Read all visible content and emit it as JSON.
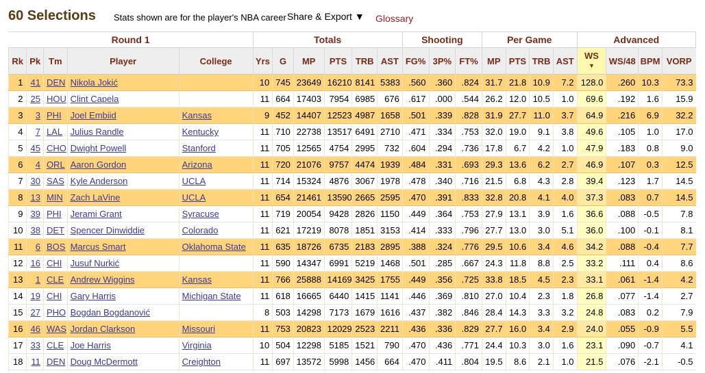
{
  "header": {
    "title": "60 Selections",
    "note": "Stats shown are for the player's NBA career",
    "share_label": "Share & Export ▼",
    "glossary_label": "Glossary"
  },
  "groups": {
    "round": "Round 1",
    "totals": "Totals",
    "shooting": "Shooting",
    "per_game": "Per Game",
    "advanced": "Advanced"
  },
  "columns": [
    "Rk",
    "Pk",
    "Tm",
    "Player",
    "College",
    "Yrs",
    "G",
    "MP",
    "PTS",
    "TRB",
    "AST",
    "FG%",
    "3P%",
    "FT%",
    "MP",
    "PTS",
    "TRB",
    "AST",
    "WS",
    "WS/48",
    "BPM",
    "VORP"
  ],
  "sort_indicator": "▼",
  "rows": [
    {
      "rk": "1",
      "pk": "41",
      "tm": "DEN",
      "player": "Nikola Jokić",
      "college": "",
      "yrs": "10",
      "g": "745",
      "mp": "23649",
      "pts": "16210",
      "trb": "8141",
      "ast": "5383",
      "fg": ".560",
      "tp": ".360",
      "ft": ".824",
      "mpg": "31.7",
      "ptsg": "21.8",
      "trbg": "10.9",
      "astg": "7.2",
      "ws": "128.0",
      "ws48": ".260",
      "bpm": "10.3",
      "vorp": "73.3",
      "hl": true
    },
    {
      "rk": "2",
      "pk": "25",
      "tm": "HOU",
      "player": "Clint Capela",
      "college": "",
      "yrs": "11",
      "g": "664",
      "mp": "17403",
      "pts": "7954",
      "trb": "6985",
      "ast": "676",
      "fg": ".617",
      "tp": ".000",
      "ft": ".544",
      "mpg": "26.2",
      "ptsg": "12.0",
      "trbg": "10.5",
      "astg": "1.0",
      "ws": "69.6",
      "ws48": ".192",
      "bpm": "1.6",
      "vorp": "15.9",
      "hl": false
    },
    {
      "rk": "3",
      "pk": "3",
      "tm": "PHI",
      "player": "Joel Embiid",
      "college": "Kansas",
      "yrs": "9",
      "g": "452",
      "mp": "14407",
      "pts": "12523",
      "trb": "4987",
      "ast": "1658",
      "fg": ".501",
      "tp": ".339",
      "ft": ".828",
      "mpg": "31.9",
      "ptsg": "27.7",
      "trbg": "11.0",
      "astg": "3.7",
      "ws": "64.9",
      "ws48": ".216",
      "bpm": "6.9",
      "vorp": "32.2",
      "hl": true
    },
    {
      "rk": "4",
      "pk": "7",
      "tm": "LAL",
      "player": "Julius Randle",
      "college": "Kentucky",
      "yrs": "11",
      "g": "710",
      "mp": "22738",
      "pts": "13517",
      "trb": "6491",
      "ast": "2710",
      "fg": ".471",
      "tp": ".334",
      "ft": ".753",
      "mpg": "32.0",
      "ptsg": "19.0",
      "trbg": "9.1",
      "astg": "3.8",
      "ws": "49.6",
      "ws48": ".105",
      "bpm": "1.0",
      "vorp": "17.0",
      "hl": false
    },
    {
      "rk": "5",
      "pk": "45",
      "tm": "CHO",
      "player": "Dwight Powell",
      "college": "Stanford",
      "yrs": "11",
      "g": "705",
      "mp": "12565",
      "pts": "4754",
      "trb": "2995",
      "ast": "732",
      "fg": ".604",
      "tp": ".294",
      "ft": ".736",
      "mpg": "17.8",
      "ptsg": "6.7",
      "trbg": "4.2",
      "astg": "1.0",
      "ws": "47.9",
      "ws48": ".183",
      "bpm": "0.8",
      "vorp": "9.0",
      "hl": false
    },
    {
      "rk": "6",
      "pk": "4",
      "tm": "ORL",
      "player": "Aaron Gordon",
      "college": "Arizona",
      "yrs": "11",
      "g": "720",
      "mp": "21076",
      "pts": "9757",
      "trb": "4474",
      "ast": "1939",
      "fg": ".484",
      "tp": ".331",
      "ft": ".693",
      "mpg": "29.3",
      "ptsg": "13.6",
      "trbg": "6.2",
      "astg": "2.7",
      "ws": "46.9",
      "ws48": ".107",
      "bpm": "0.3",
      "vorp": "12.5",
      "hl": true
    },
    {
      "rk": "7",
      "pk": "30",
      "tm": "SAS",
      "player": "Kyle Anderson",
      "college": "UCLA",
      "yrs": "11",
      "g": "714",
      "mp": "15324",
      "pts": "4876",
      "trb": "3067",
      "ast": "1978",
      "fg": ".478",
      "tp": ".340",
      "ft": ".716",
      "mpg": "21.5",
      "ptsg": "6.8",
      "trbg": "4.3",
      "astg": "2.8",
      "ws": "39.4",
      "ws48": ".123",
      "bpm": "1.7",
      "vorp": "14.5",
      "hl": false
    },
    {
      "rk": "8",
      "pk": "13",
      "tm": "MIN",
      "player": "Zach LaVine",
      "college": "UCLA",
      "yrs": "11",
      "g": "654",
      "mp": "21461",
      "pts": "13590",
      "trb": "2665",
      "ast": "2595",
      "fg": ".470",
      "tp": ".391",
      "ft": ".833",
      "mpg": "32.8",
      "ptsg": "20.8",
      "trbg": "4.1",
      "astg": "4.0",
      "ws": "37.3",
      "ws48": ".083",
      "bpm": "0.7",
      "vorp": "14.5",
      "hl": true
    },
    {
      "rk": "9",
      "pk": "39",
      "tm": "PHI",
      "player": "Jerami Grant",
      "college": "Syracuse",
      "yrs": "11",
      "g": "719",
      "mp": "20054",
      "pts": "9428",
      "trb": "2826",
      "ast": "1150",
      "fg": ".449",
      "tp": ".364",
      "ft": ".753",
      "mpg": "27.9",
      "ptsg": "13.1",
      "trbg": "3.9",
      "astg": "1.6",
      "ws": "36.6",
      "ws48": ".088",
      "bpm": "-0.5",
      "vorp": "7.8",
      "hl": false
    },
    {
      "rk": "10",
      "pk": "38",
      "tm": "DET",
      "player": "Spencer Dinwiddie",
      "college": "Colorado",
      "yrs": "11",
      "g": "621",
      "mp": "17219",
      "pts": "8078",
      "trb": "1851",
      "ast": "3153",
      "fg": ".414",
      "tp": ".333",
      "ft": ".796",
      "mpg": "27.7",
      "ptsg": "13.0",
      "trbg": "3.0",
      "astg": "5.1",
      "ws": "36.0",
      "ws48": ".100",
      "bpm": "-0.1",
      "vorp": "8.1",
      "hl": false
    },
    {
      "rk": "11",
      "pk": "6",
      "tm": "BOS",
      "player": "Marcus Smart",
      "college": "Oklahoma State",
      "yrs": "11",
      "g": "635",
      "mp": "18726",
      "pts": "6735",
      "trb": "2183",
      "ast": "2895",
      "fg": ".388",
      "tp": ".324",
      "ft": ".776",
      "mpg": "29.5",
      "ptsg": "10.6",
      "trbg": "3.4",
      "astg": "4.6",
      "ws": "34.2",
      "ws48": ".088",
      "bpm": "-0.4",
      "vorp": "7.7",
      "hl": true
    },
    {
      "rk": "12",
      "pk": "16",
      "tm": "CHI",
      "player": "Jusuf Nurkić",
      "college": "",
      "yrs": "11",
      "g": "590",
      "mp": "14347",
      "pts": "6991",
      "trb": "5219",
      "ast": "1468",
      "fg": ".501",
      "tp": ".285",
      "ft": ".667",
      "mpg": "24.3",
      "ptsg": "11.8",
      "trbg": "8.8",
      "astg": "2.5",
      "ws": "33.2",
      "ws48": ".111",
      "bpm": "0.4",
      "vorp": "8.6",
      "hl": false
    },
    {
      "rk": "13",
      "pk": "1",
      "tm": "CLE",
      "player": "Andrew Wiggins",
      "college": "Kansas",
      "yrs": "11",
      "g": "766",
      "mp": "25888",
      "pts": "14169",
      "trb": "3425",
      "ast": "1755",
      "fg": ".449",
      "tp": ".356",
      "ft": ".725",
      "mpg": "33.8",
      "ptsg": "18.5",
      "trbg": "4.5",
      "astg": "2.3",
      "ws": "33.1",
      "ws48": ".061",
      "bpm": "-1.4",
      "vorp": "4.2",
      "hl": true
    },
    {
      "rk": "14",
      "pk": "19",
      "tm": "CHI",
      "player": "Gary Harris",
      "college": "Michigan State",
      "yrs": "11",
      "g": "618",
      "mp": "16665",
      "pts": "6440",
      "trb": "1415",
      "ast": "1141",
      "fg": ".446",
      "tp": ".369",
      "ft": ".810",
      "mpg": "27.0",
      "ptsg": "10.4",
      "trbg": "2.3",
      "astg": "1.8",
      "ws": "26.8",
      "ws48": ".077",
      "bpm": "-1.4",
      "vorp": "2.7",
      "hl": false
    },
    {
      "rk": "15",
      "pk": "27",
      "tm": "PHO",
      "player": "Bogdan Bogdanović",
      "college": "",
      "yrs": "8",
      "g": "503",
      "mp": "14298",
      "pts": "7173",
      "trb": "1679",
      "ast": "1616",
      "fg": ".437",
      "tp": ".382",
      "ft": ".846",
      "mpg": "28.4",
      "ptsg": "14.3",
      "trbg": "3.3",
      "astg": "3.2",
      "ws": "24.8",
      "ws48": ".083",
      "bpm": "0.2",
      "vorp": "7.9",
      "hl": false
    },
    {
      "rk": "16",
      "pk": "46",
      "tm": "WAS",
      "player": "Jordan Clarkson",
      "college": "Missouri",
      "yrs": "11",
      "g": "753",
      "mp": "20823",
      "pts": "12029",
      "trb": "2523",
      "ast": "2211",
      "fg": ".436",
      "tp": ".336",
      "ft": ".829",
      "mpg": "27.7",
      "ptsg": "16.0",
      "trbg": "3.4",
      "astg": "2.9",
      "ws": "24.0",
      "ws48": ".055",
      "bpm": "-0.9",
      "vorp": "5.5",
      "hl": true
    },
    {
      "rk": "17",
      "pk": "33",
      "tm": "CLE",
      "player": "Joe Harris",
      "college": "Virginia",
      "yrs": "10",
      "g": "504",
      "mp": "12298",
      "pts": "5185",
      "trb": "1521",
      "ast": "790",
      "fg": ".470",
      "tp": ".436",
      "ft": ".771",
      "mpg": "24.4",
      "ptsg": "10.3",
      "trbg": "3.0",
      "astg": "1.6",
      "ws": "23.1",
      "ws48": ".090",
      "bpm": "-0.7",
      "vorp": "4.1",
      "hl": false
    },
    {
      "rk": "18",
      "pk": "11",
      "tm": "DEN",
      "player": "Doug McDermott",
      "college": "Creighton",
      "yrs": "11",
      "g": "697",
      "mp": "13572",
      "pts": "5998",
      "trb": "1456",
      "ast": "664",
      "fg": ".470",
      "tp": ".411",
      "ft": ".804",
      "mpg": "19.5",
      "ptsg": "8.6",
      "trbg": "2.1",
      "astg": "1.0",
      "ws": "21.5",
      "ws48": ".076",
      "bpm": "-2.1",
      "vorp": "-0.5",
      "hl": false
    }
  ]
}
